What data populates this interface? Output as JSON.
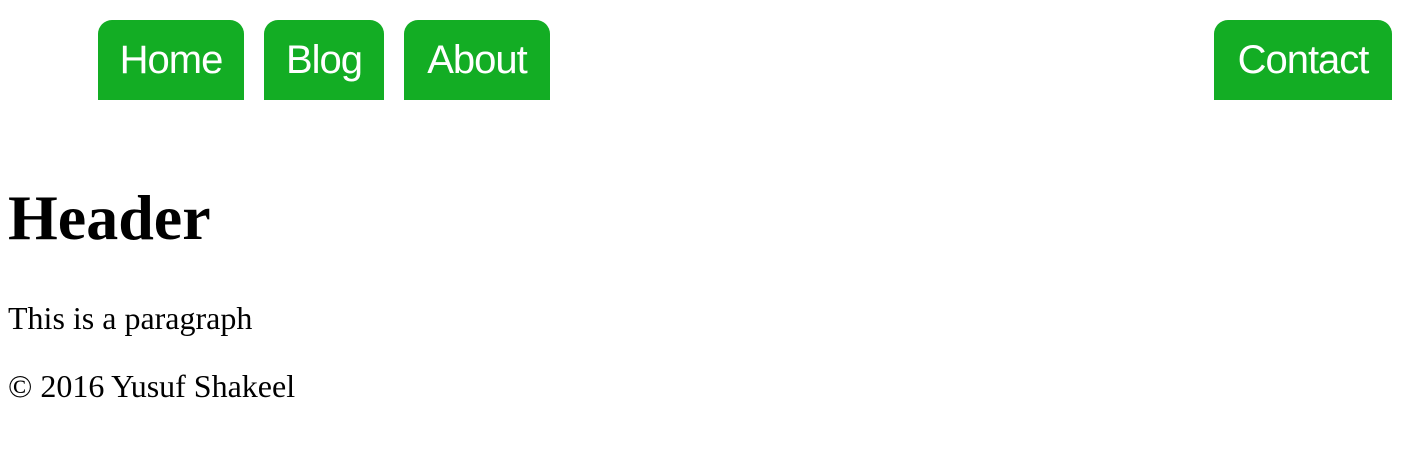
{
  "nav": {
    "items": [
      {
        "label": "Home"
      },
      {
        "label": "Blog"
      },
      {
        "label": "About"
      },
      {
        "label": "Contact"
      }
    ]
  },
  "main": {
    "header": "Header",
    "paragraph": "This is a paragraph"
  },
  "footer": {
    "text": "© 2016 Yusuf Shakeel"
  },
  "colors": {
    "nav_button_bg": "#13ad24",
    "nav_button_text": "#ffffff",
    "page_bg": "#ffffff",
    "text": "#000000"
  }
}
